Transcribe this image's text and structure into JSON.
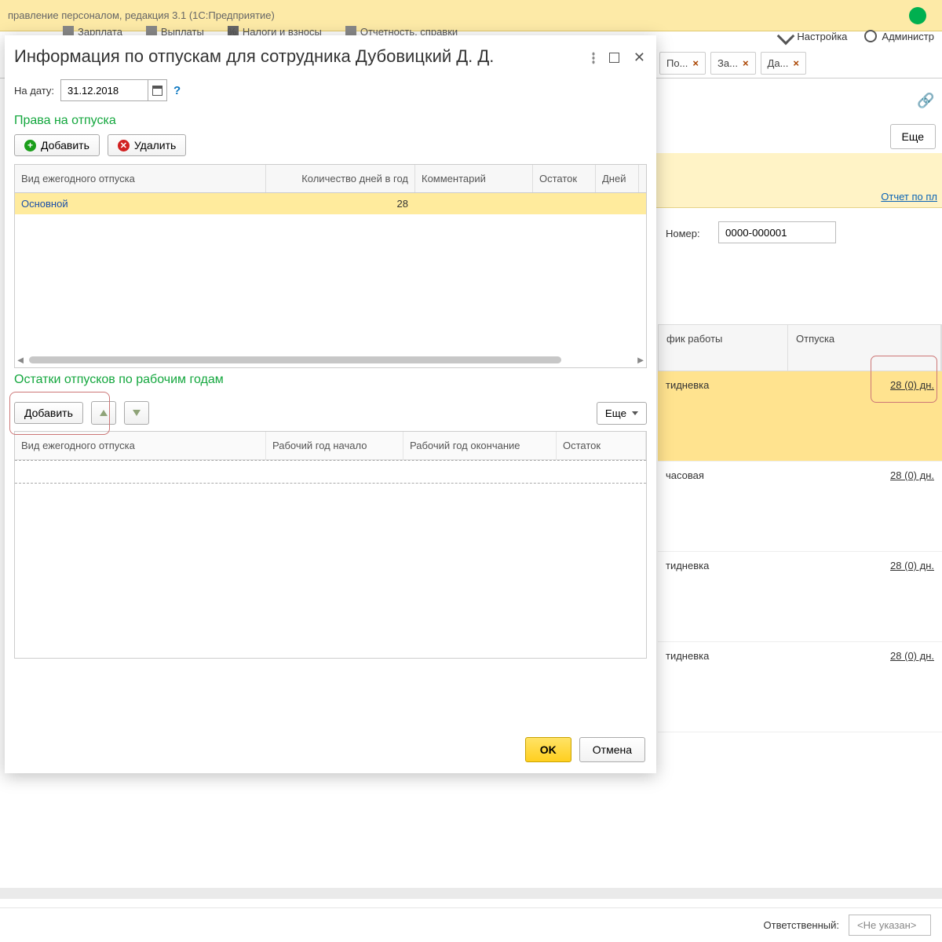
{
  "topbar": {
    "title_frag": "правление персоналом, редакция 3.1  (1С:Предприятие)"
  },
  "menu": {
    "m1": "Зарплата",
    "m2": "Выплаты",
    "m3": "Налоги и взносы",
    "m4": "Отчетность, справки",
    "m5": "Настройка",
    "m6": "Администр"
  },
  "tabs": {
    "t1": "По...",
    "t2": "За...",
    "t3": "Да..."
  },
  "bg": {
    "more": "Еще",
    "report_link": "Отчет по пл",
    "num_label": "Номер:",
    "num_value": "0000-000001",
    "gridhead1": "фик работы",
    "gridhead2": "Отпуска",
    "rows": {
      "r1c1": "тидневка",
      "r1c2": "28 (0) дн.",
      "r2c1": "часовая",
      "r2c2": "28 (0) дн.",
      "r3c1": "тидневка",
      "r3c2": "28 (0) дн.",
      "r4c1": "тидневка",
      "r4c2": "28 (0) дн."
    }
  },
  "bottom": {
    "label": "Ответственный:",
    "value": "<Не указан>"
  },
  "dialog": {
    "title": "Информация по отпускам для сотрудника Дубовицкий Д. Д.",
    "date_label": "На дату:",
    "date_value": "31.12.2018",
    "help": "?",
    "sect1": "Права на отпуска",
    "add": "Добавить",
    "del": "Удалить",
    "g1": {
      "h1": "Вид ежегодного отпуска",
      "h2": "Количество дней в год",
      "h3": "Комментарий",
      "h4": "Остаток",
      "h5": "Дней",
      "row1": {
        "c1": "Основной",
        "c2": "28"
      }
    },
    "sect2": "Остатки отпусков по рабочим годам",
    "add2": "Добавить",
    "more": "Еще",
    "g2": {
      "h1": "Вид ежегодного отпуска",
      "h2": "Рабочий год начало",
      "h3": "Рабочий год окончание",
      "h4": "Остаток"
    },
    "ok": "OK",
    "cancel": "Отмена"
  }
}
